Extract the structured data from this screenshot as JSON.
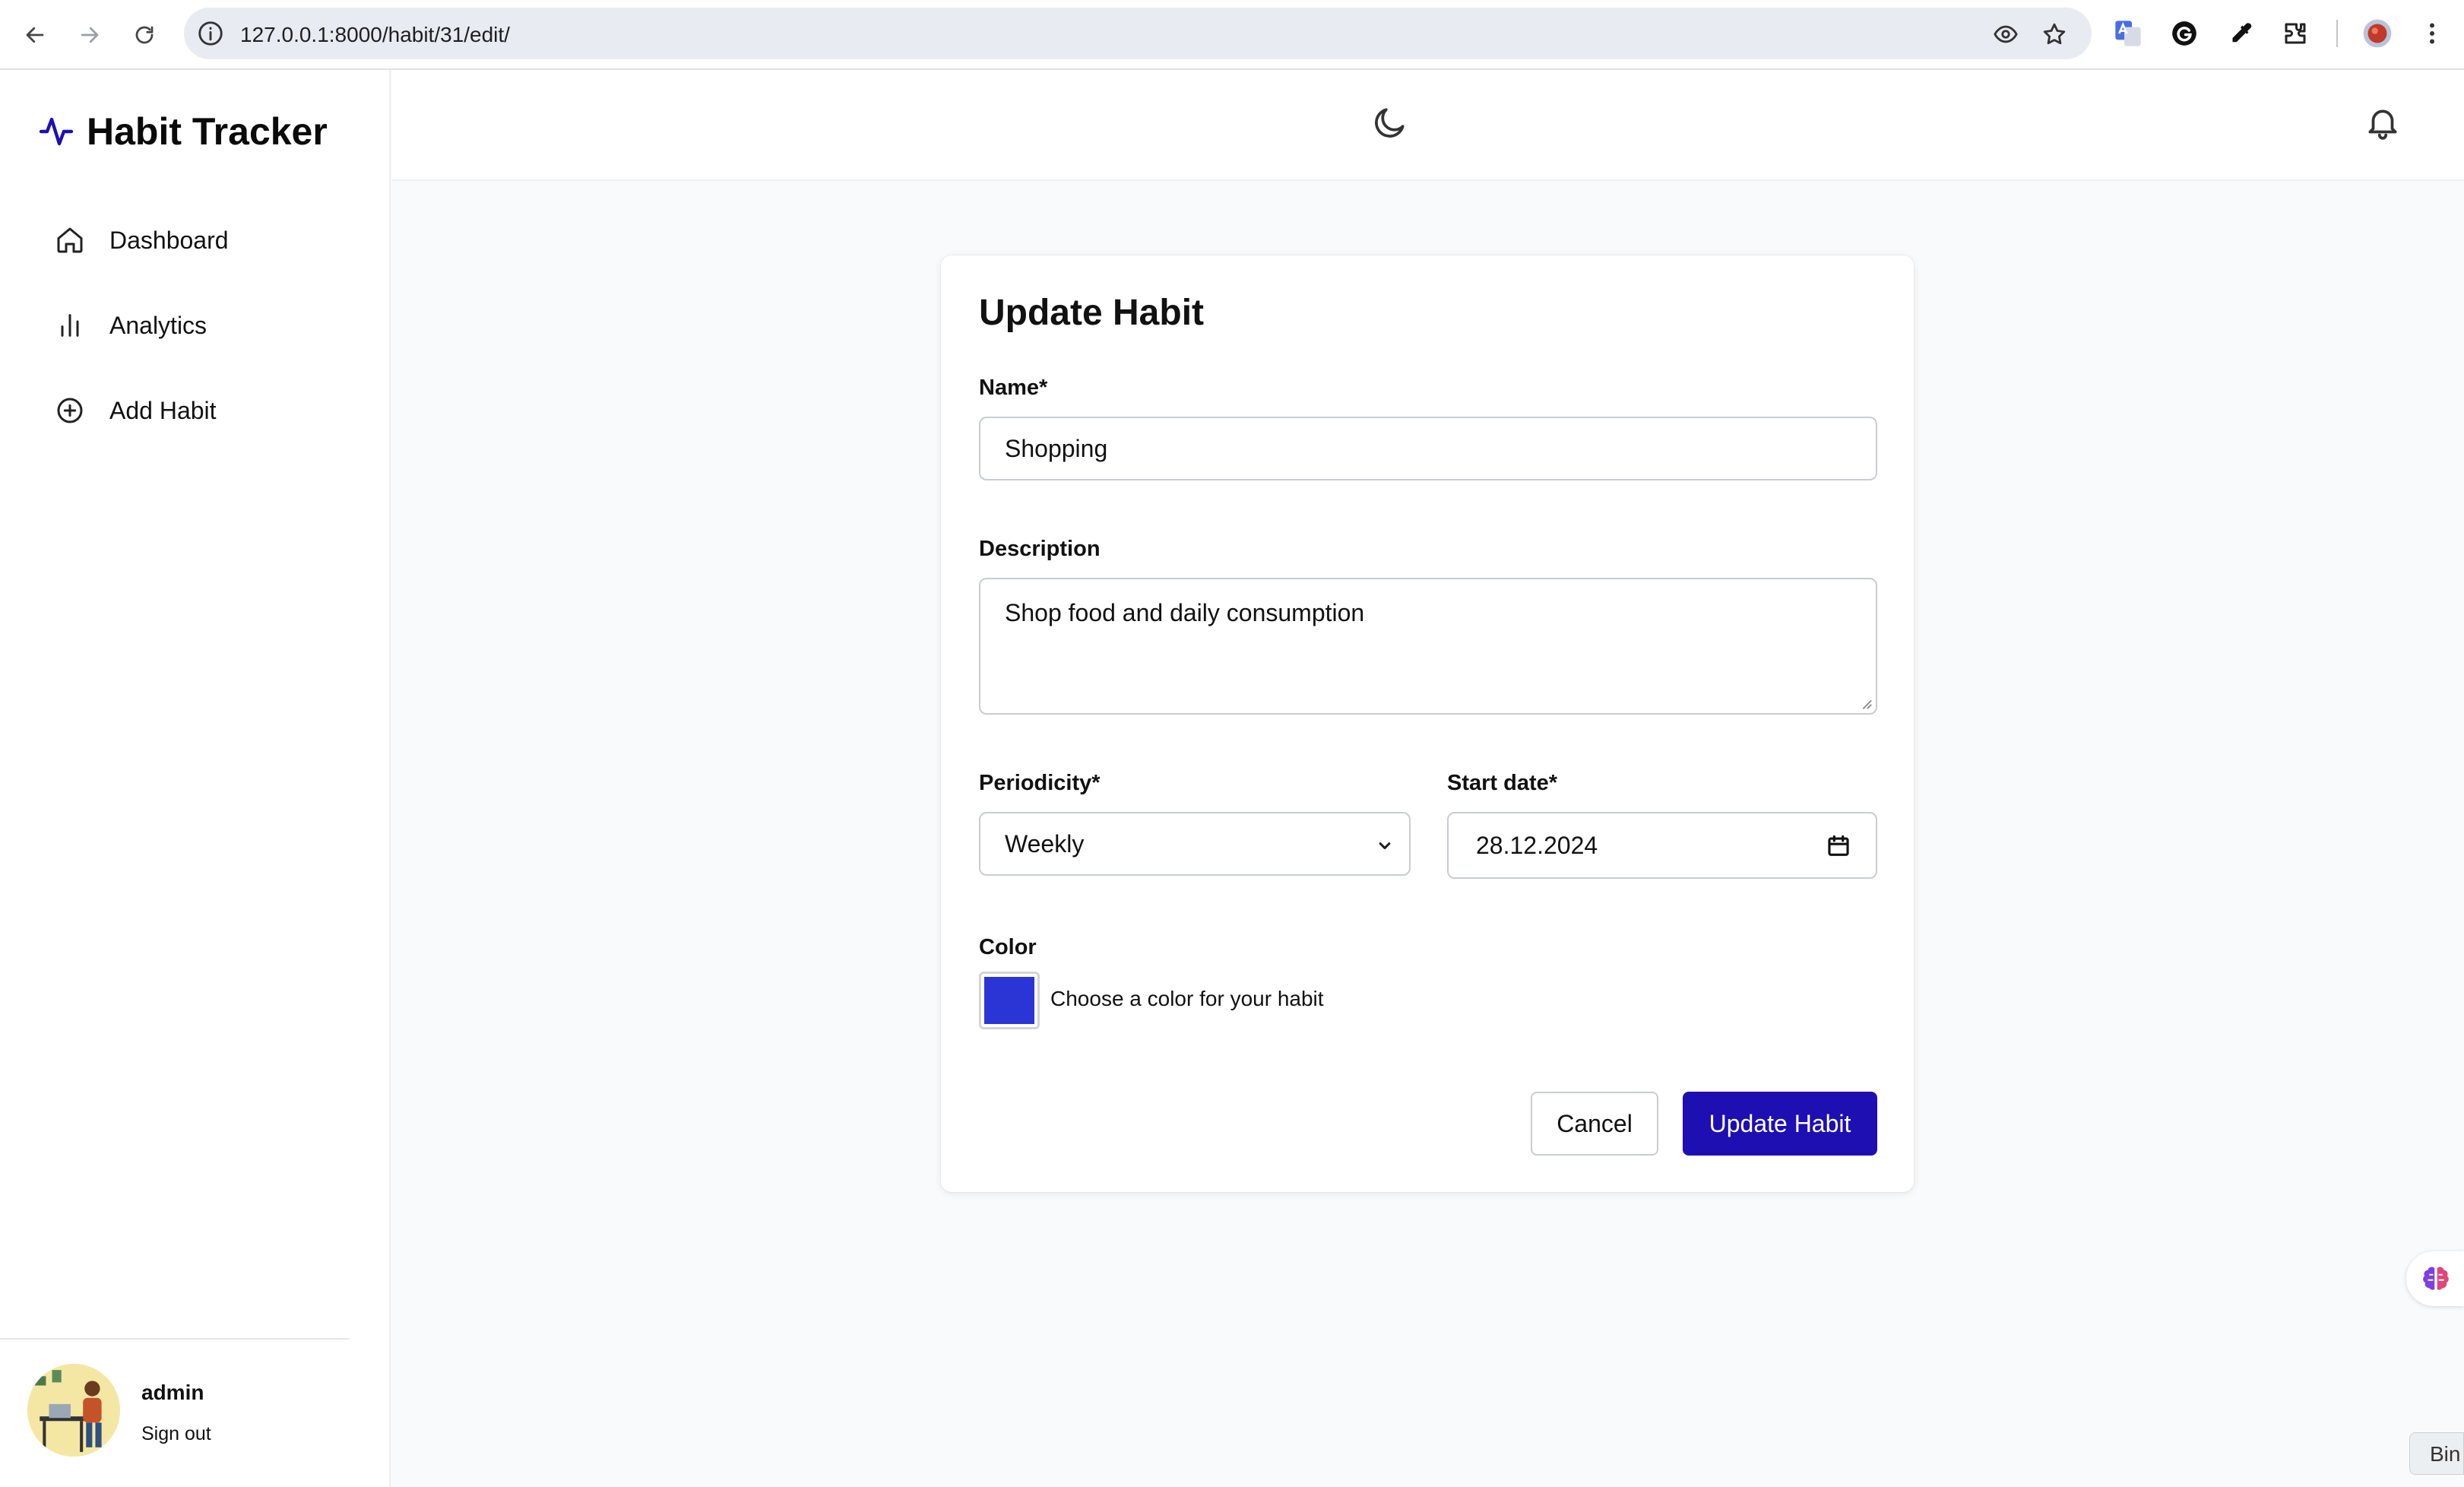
{
  "browser": {
    "url": "127.0.0.1:8000/habit/31/edit/"
  },
  "sidebar": {
    "brand": "Habit Tracker",
    "items": [
      {
        "label": "Dashboard",
        "icon": "home-icon"
      },
      {
        "label": "Analytics",
        "icon": "bar-chart-icon"
      },
      {
        "label": "Add Habit",
        "icon": "plus-circle-icon"
      }
    ],
    "user": {
      "name": "admin",
      "sign_out": "Sign out"
    }
  },
  "form": {
    "title": "Update Habit",
    "name_label": "Name*",
    "name_value": "Shopping",
    "description_label": "Description",
    "description_value": "Shop food and daily consumption",
    "periodicity_label": "Periodicity*",
    "periodicity_value": "Weekly",
    "start_date_label": "Start date*",
    "start_date_value": "28.12.2024",
    "color_label": "Color",
    "color_hint": "Choose a color for your habit",
    "color_value": "#2b35d6",
    "cancel_label": "Cancel",
    "submit_label": "Update Habit"
  },
  "theme": {
    "accent": "#1e0fb3",
    "brand_icon_color": "#1e0fb3"
  },
  "floating": {
    "bin_label": "Bin"
  }
}
